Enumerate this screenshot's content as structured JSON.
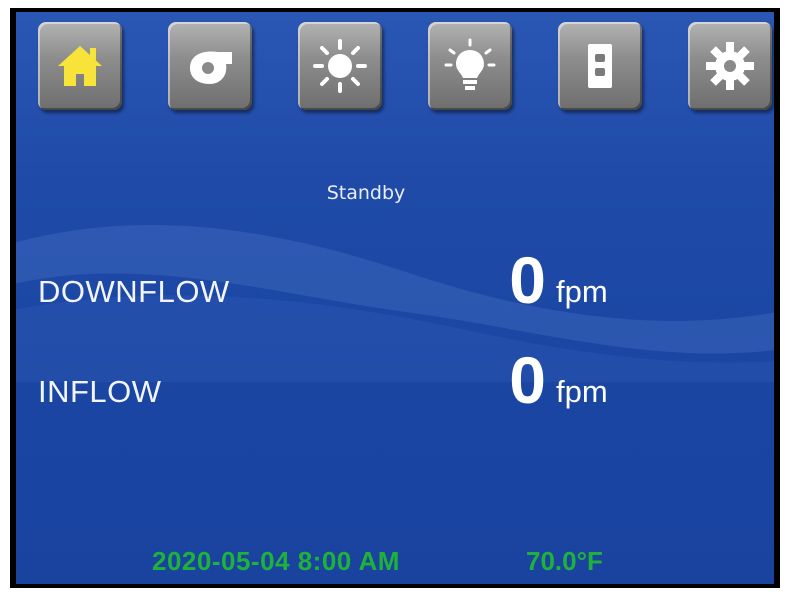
{
  "toolbar": {
    "buttons": [
      {
        "icon": "home-icon",
        "color": "#f7e33a"
      },
      {
        "icon": "blower-icon",
        "color": "#ffffff"
      },
      {
        "icon": "uv-light-icon",
        "color": "#ffffff"
      },
      {
        "icon": "light-bulb-icon",
        "color": "#ffffff"
      },
      {
        "icon": "outlet-icon",
        "color": "#ffffff"
      },
      {
        "icon": "gear-icon",
        "color": "#ffffff"
      }
    ]
  },
  "status": "Standby",
  "readings": {
    "downflow": {
      "label": "DOWNFLOW",
      "value": "0",
      "unit": "fpm"
    },
    "inflow": {
      "label": "INFLOW",
      "value": "0",
      "unit": "fpm"
    }
  },
  "footer": {
    "datetime": "2020-05-04 8:00 AM",
    "temperature": "70.0°F",
    "color": "#1fb23a"
  }
}
